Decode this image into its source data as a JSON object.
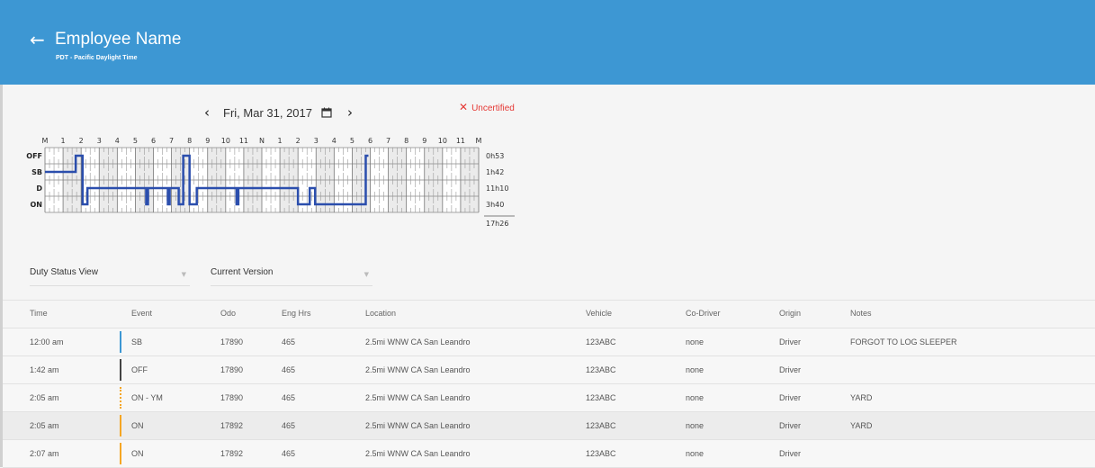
{
  "header": {
    "title": "Employee Name",
    "subtitle": "PDT - Pacific Daylight Time"
  },
  "date_nav": {
    "date": "Fri, Mar 31, 2017"
  },
  "status": {
    "uncertified_label": "Uncertified",
    "uncertified_color": "#e53935"
  },
  "graph": {
    "hour_labels": [
      "M",
      "1",
      "2",
      "3",
      "4",
      "5",
      "6",
      "7",
      "8",
      "9",
      "10",
      "11",
      "N",
      "1",
      "2",
      "3",
      "4",
      "5",
      "6",
      "7",
      "8",
      "9",
      "10",
      "11",
      "M"
    ],
    "status_labels": [
      "OFF",
      "SB",
      "D",
      "ON"
    ],
    "totals": [
      "0h53",
      "1h42",
      "11h10",
      "3h40"
    ],
    "grand_total": "17h26",
    "line_color": "#2b4ead",
    "segments": [
      {
        "status": "SB",
        "start": 0,
        "end": 1.7
      },
      {
        "status": "OFF",
        "start": 1.7,
        "end": 2.08
      },
      {
        "status": "ON",
        "start": 2.08,
        "end": 2.35
      },
      {
        "status": "D",
        "start": 2.35,
        "end": 5.6
      },
      {
        "status": "ON",
        "start": 5.6,
        "end": 5.7
      },
      {
        "status": "D",
        "start": 5.7,
        "end": 6.8
      },
      {
        "status": "ON",
        "start": 6.8,
        "end": 6.9
      },
      {
        "status": "D",
        "start": 6.9,
        "end": 7.4
      },
      {
        "status": "ON",
        "start": 7.4,
        "end": 7.65
      },
      {
        "status": "OFF",
        "start": 7.65,
        "end": 8.0
      },
      {
        "status": "ON",
        "start": 8.0,
        "end": 8.4
      },
      {
        "status": "D",
        "start": 8.4,
        "end": 10.6
      },
      {
        "status": "ON",
        "start": 10.6,
        "end": 10.7
      },
      {
        "status": "D",
        "start": 10.7,
        "end": 14.0
      },
      {
        "status": "ON",
        "start": 14.0,
        "end": 14.65
      },
      {
        "status": "D",
        "start": 14.65,
        "end": 14.95
      },
      {
        "status": "ON",
        "start": 14.95,
        "end": 17.75
      },
      {
        "status": "OFF",
        "start": 17.75,
        "end": 17.9
      }
    ]
  },
  "filters": {
    "view": "Duty Status View",
    "version": "Current Version"
  },
  "table": {
    "columns": [
      "Time",
      "Event",
      "Odo",
      "Eng Hrs",
      "Location",
      "Vehicle",
      "Co-Driver",
      "Origin",
      "Notes"
    ],
    "rows": [
      {
        "time": "12:00 am",
        "event": "SB",
        "odo": "17890",
        "eng": "465",
        "location": "2.5mi WNW CA San Leandro",
        "vehicle": "123ABC",
        "codriver": "none",
        "origin": "Driver",
        "notes": "FORGOT TO LOG SLEEPER",
        "bar_color": "#3d97d3",
        "dotted": false
      },
      {
        "time": "1:42 am",
        "event": "OFF",
        "odo": "17890",
        "eng": "465",
        "location": "2.5mi WNW CA San Leandro",
        "vehicle": "123ABC",
        "codriver": "none",
        "origin": "Driver",
        "notes": "",
        "bar_color": "#444444",
        "dotted": false
      },
      {
        "time": "2:05 am",
        "event": "ON - YM",
        "odo": "17890",
        "eng": "465",
        "location": "2.5mi WNW CA San Leandro",
        "vehicle": "123ABC",
        "codriver": "none",
        "origin": "Driver",
        "notes": "YARD",
        "bar_color": "#f5a623",
        "dotted": true
      },
      {
        "time": "2:05 am",
        "event": "ON",
        "odo": "17892",
        "eng": "465",
        "location": "2.5mi WNW CA San Leandro",
        "vehicle": "123ABC",
        "codriver": "none",
        "origin": "Driver",
        "notes": "YARD",
        "bar_color": "#f5a623",
        "dotted": false
      },
      {
        "time": "2:07 am",
        "event": "ON",
        "odo": "17892",
        "eng": "465",
        "location": "2.5mi WNW CA San Leandro",
        "vehicle": "123ABC",
        "codriver": "none",
        "origin": "Driver",
        "notes": "",
        "bar_color": "#f5a623",
        "dotted": false
      }
    ]
  }
}
